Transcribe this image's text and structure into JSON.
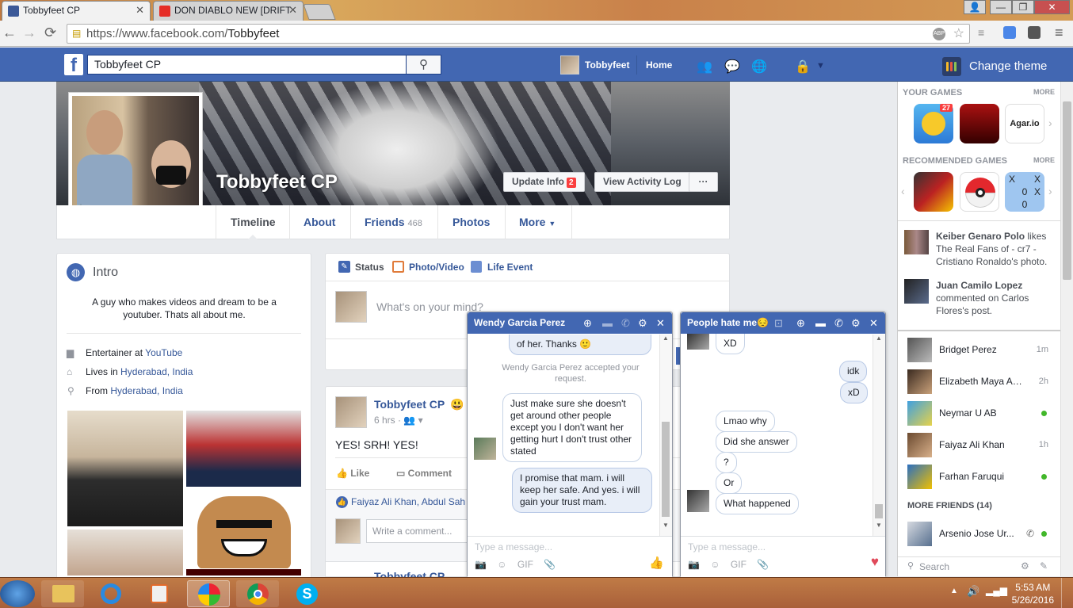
{
  "browser": {
    "tabs": [
      {
        "title": "Tobbyfeet CP",
        "active": true
      },
      {
        "title": "DON DIABLO NEW [DRIFT",
        "active": false
      }
    ],
    "url_prefix": "https://www.facebook.com/",
    "url_path": "Tobbyfeet"
  },
  "header": {
    "search_value": "Tobbyfeet CP",
    "user": "Tobbyfeet",
    "home": "Home",
    "change_theme": "Change theme"
  },
  "profile": {
    "name": "Tobbyfeet CP",
    "update_info": "Update Info",
    "update_badge": "2",
    "activity_log": "View Activity Log",
    "more_dots": "···",
    "tabs": {
      "timeline": "Timeline",
      "about": "About",
      "friends": "Friends",
      "friends_count": "468",
      "photos": "Photos",
      "more": "More"
    }
  },
  "intro": {
    "title": "Intro",
    "bio": "A guy who makes videos and dream to be a youtuber. Thats all about me.",
    "work_prefix": "Entertainer at ",
    "work_link": "YouTube",
    "lives_prefix": "Lives in ",
    "lives_link": "Hyderabad, India",
    "from_prefix": "From ",
    "from_link": "Hyderabad, India"
  },
  "composer": {
    "status": "Status",
    "photo": "Photo/Video",
    "life": "Life Event",
    "placeholder": "What's on your mind?"
  },
  "post": {
    "author": "Tobbyfeet CP",
    "time": "6 hrs · ",
    "text": "YES! SRH! YES!",
    "like": "Like",
    "comment": "Comment",
    "likers": "Faiyaz Ali Khan, Abdul Sah",
    "write_comment": "Write a comment...",
    "next_author": "Tobbyfeet CP"
  },
  "rail": {
    "your_games": "YOUR GAMES",
    "more": "MORE",
    "game_badge": "27",
    "agar": "Agar.io",
    "recommended": "RECOMMENDED GAMES",
    "ttt": [
      "X",
      "",
      "X",
      "",
      "0",
      "X",
      "",
      "0",
      ""
    ],
    "ticker": [
      {
        "name": "Keiber Genaro Polo",
        "rest": " likes The Real Fans of - cr7 - Cristiano Ronaldo's photo."
      },
      {
        "name": "Juan Camilo Lopez",
        "rest": " commented on Carlos Flores's post."
      }
    ],
    "friends": [
      {
        "name": "Bridget Perez",
        "status": "1m"
      },
      {
        "name": "Elizabeth Maya Agu...",
        "status": "2h"
      },
      {
        "name": "Neymar U AB",
        "status": ""
      },
      {
        "name": "Faiyaz Ali Khan",
        "status": "1h"
      },
      {
        "name": "Farhan Faruqui",
        "status": ""
      }
    ],
    "more_friends": "MORE FRIENDS (14)",
    "more_friend": {
      "name": "Arsenio Jose Ur..."
    },
    "search": "Search"
  },
  "chat1": {
    "title": "Wendy Garcia Perez",
    "msg_top": "of her. Thanks 🙂",
    "system": "Wendy Garcia Perez accepted your request.",
    "msg_them": "Just make sure she doesn't get around other people except you I don't want her getting hurt I don't trust other stated",
    "msg_me": "I promise that mam. i will keep her safe. And yes. i will gain your trust mam.",
    "placeholder": "Type a message...",
    "gif": "GIF"
  },
  "chat2": {
    "title": "People hate me😔",
    "msgs_them_top": "XD",
    "msgs_me": [
      "idk",
      "xD"
    ],
    "msgs_them": [
      "Lmao why",
      "Did she answer",
      "?",
      "Or",
      "What happened"
    ],
    "placeholder": "Type a message...",
    "gif": "GIF"
  },
  "taskbar": {
    "time": "5:53 AM",
    "date": "5/26/2016"
  },
  "colors": {
    "fb_blue": "#4267b2",
    "link": "#365899",
    "online": "#42b72a"
  }
}
